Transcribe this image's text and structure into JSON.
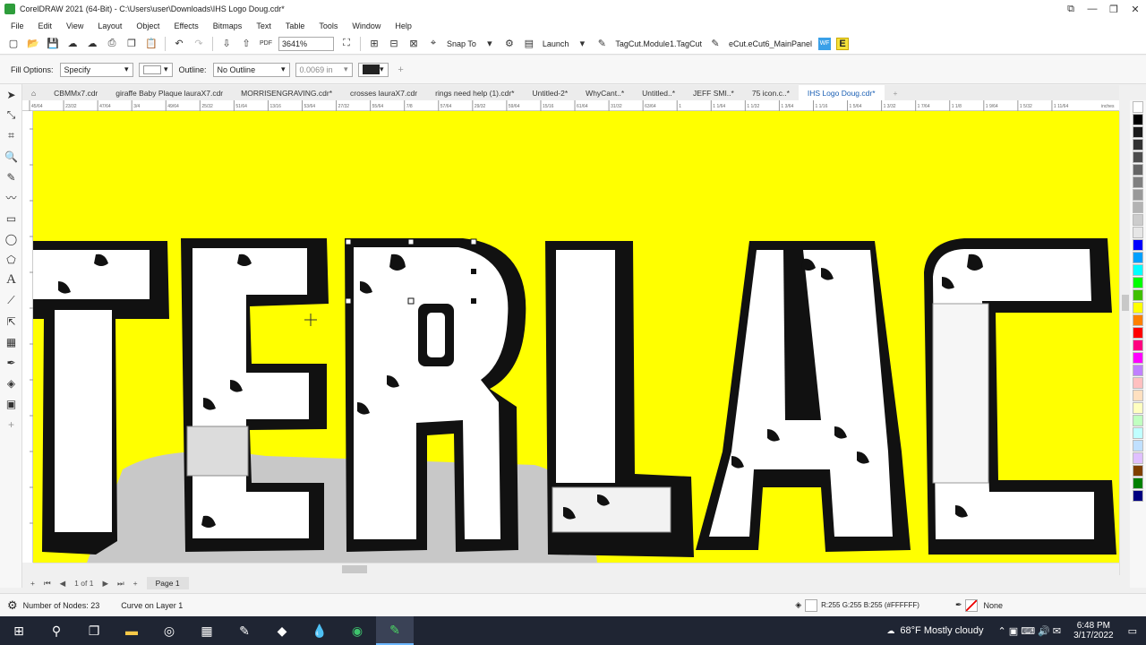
{
  "window": {
    "title": "CorelDRAW 2021 (64-Bit) - C:\\Users\\user\\Downloads\\IHS Logo Doug.cdr*",
    "min": "—",
    "max": "❐",
    "close": "✕"
  },
  "menu": [
    "File",
    "Edit",
    "View",
    "Layout",
    "Object",
    "Effects",
    "Bitmaps",
    "Text",
    "Table",
    "Tools",
    "Window",
    "Help"
  ],
  "toolbar": {
    "zoom": "3641%",
    "snap_to": "Snap To",
    "launch": "Launch",
    "tagcut": "TagCut.Module1.TagCut",
    "ecut": "eCut.eCut6_MainPanel",
    "pdf_label": "PDF",
    "e_label": "E",
    "wf_label": "WF"
  },
  "properties": {
    "fill_options_label": "Fill Options:",
    "fill_options_value": "Specify",
    "outline_label": "Outline:",
    "outline_value": "No Outline",
    "outline_width": "0.0069 in"
  },
  "doc_tabs": [
    "CBMMx7.cdr",
    "giraffe Baby Plaque lauraX7.cdr",
    "MORRISENGRAVING.cdr*",
    "crosses lauraX7.cdr",
    "rings need help (1).cdr*",
    "Untitled-2*",
    "WhyCant..*",
    "Untitled..*",
    "JEFF SMI..*",
    "75 icon.c..*",
    "IHS Logo Doug.cdr*"
  ],
  "active_tab_index": 10,
  "ruler": {
    "h_ticks": [
      "45/64",
      "23/32",
      "47/64",
      "3/4",
      "49/64",
      "25/32",
      "51/64",
      "13/16",
      "53/64",
      "27/32",
      "55/64",
      "7/8",
      "57/64",
      "29/32",
      "59/64",
      "15/16",
      "61/64",
      "31/32",
      "63/64",
      "1",
      "1 1/64",
      "1 1/32",
      "1 3/64",
      "1 1/16",
      "1 5/64",
      "1 3/32",
      "1 7/64",
      "1 1/8",
      "1 9/64",
      "1 5/32",
      "1 11/64"
    ],
    "unit": "inches"
  },
  "canvas": {
    "letters": "TERLAC",
    "background_color": "#ffff00",
    "letter_fill": "#ffffff",
    "outline_color": "#111111",
    "shadow_color": "#c8c8c8"
  },
  "palette": [
    "#ffffff",
    "#000000",
    "#1a1a1a",
    "#333333",
    "#4d4d4d",
    "#666666",
    "#808080",
    "#999999",
    "#b3b3b3",
    "#cccccc",
    "#e6e6e6",
    "#0000ff",
    "#00a0ff",
    "#00ffff",
    "#00ff00",
    "#40c000",
    "#ffff00",
    "#ff8000",
    "#ff0000",
    "#ff0080",
    "#ff00ff",
    "#c080ff",
    "#ffc0c0",
    "#ffe0c0",
    "#ffffc0",
    "#c0ffc0",
    "#c0ffff",
    "#c0e0ff",
    "#e0c0ff",
    "#804000",
    "#008000",
    "#000080"
  ],
  "page_nav": {
    "page_of": "1 of 1",
    "page_tab": "Page 1"
  },
  "status": {
    "nodes": "Number of Nodes: 23",
    "curve": "Curve on Layer 1",
    "color_readout": "R:255 G:255 B:255 (#FFFFFF)",
    "outline": "None"
  },
  "taskbar": {
    "weather": "68°F  Mostly cloudy",
    "time": "6:48 PM",
    "date": "3/17/2022"
  }
}
